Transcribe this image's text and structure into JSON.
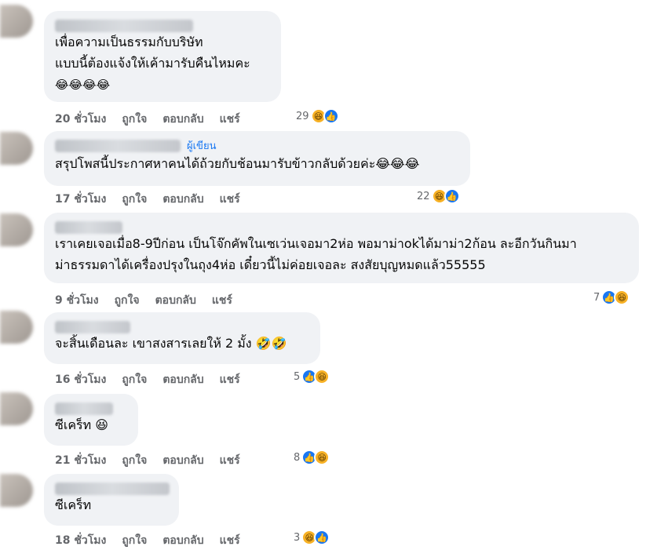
{
  "labels": {
    "like": "ถูกใจ",
    "reply": "ตอบกลับ",
    "share": "แชร์",
    "author": "ผู้เขียน"
  },
  "comments": [
    {
      "lines": [
        "เพื่อความเป็นธรรมกับบริษัท",
        "แบบนี้ต้องแจ้งให้เค้ามารับคืนไหมคะ",
        "😂😂😂😂"
      ],
      "time": "20 ชั่วโมง",
      "reactions": "29"
    },
    {
      "lines": [
        "สรุปโพสนี้ประกาศหาคนได้ถ้วยกับช้อนมารับข้าวกลับด้วยค่ะ😂😂😂"
      ],
      "time": "17 ชั่วโมง",
      "reactions": "22"
    },
    {
      "lines": [
        "เราเคยเจอเมื่อ8-9ปีก่อน เป็นโจ๊กคัพในเซเว่นเจอมา2ห่อ พอมาม่าokได้มาม่า2ก้อน ละอีกวันกินมา",
        "ม่าธรรมดาได้เครื่องปรุงในถุง4ห่อ เดี๋ยวนี้ไม่ค่อยเจอละ สงสัยบุญหมดแล้ว55555"
      ],
      "time": "9 ชั่วโมง",
      "reactions": "7"
    },
    {
      "lines": [
        "จะสิ้นเดือนละ เขาสงสารเลยให้ 2 มั้ง 🤣🤣"
      ],
      "time": "16 ชั่วโมง",
      "reactions": "5"
    },
    {
      "lines": [
        "ซีเคร็ท 😆"
      ],
      "time": "21 ชั่วโมง",
      "reactions": "8"
    },
    {
      "lines": [
        "ซีเคร็ท"
      ],
      "time": "18 ชั่วโมง",
      "reactions": "3"
    }
  ],
  "icons": {
    "haha": "haha-emoji-icon",
    "like": "like-thumb-icon"
  },
  "colors": {
    "bubble": "#f0f2f5",
    "meta": "#65676b",
    "link": "#1877f2",
    "haha": "#f7b125",
    "like": "#1877f2"
  }
}
